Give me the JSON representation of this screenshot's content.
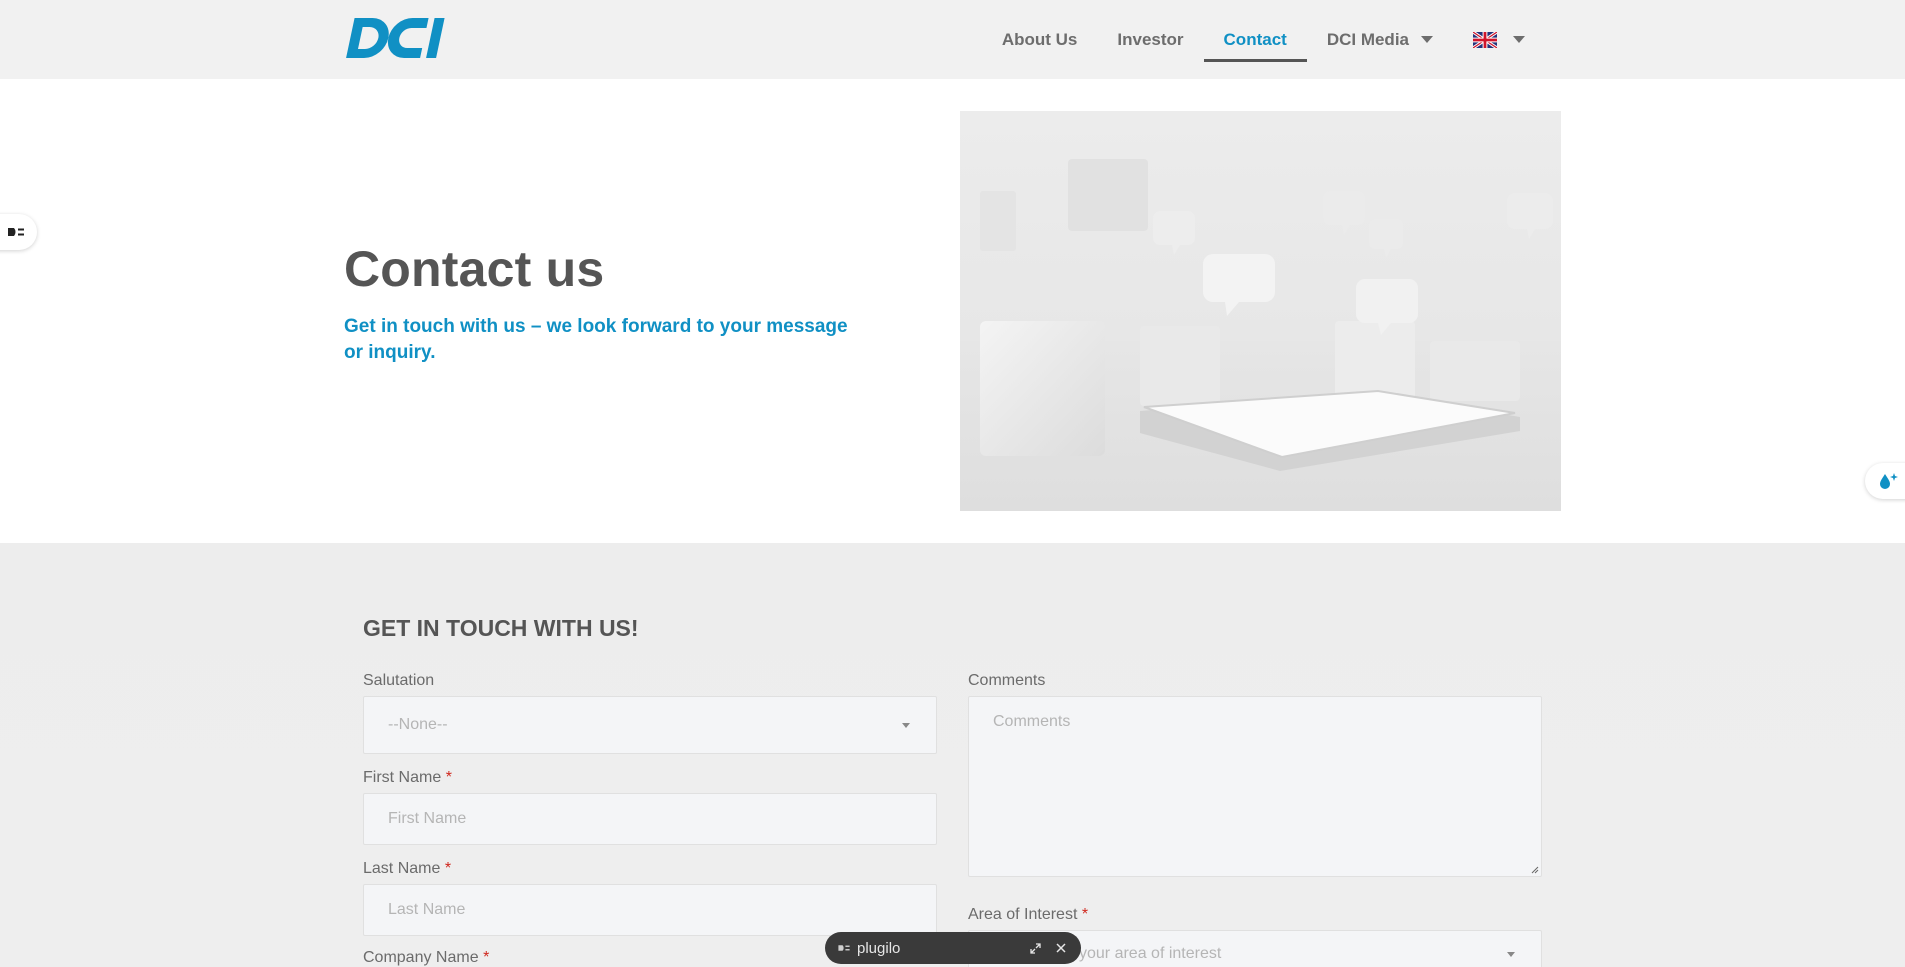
{
  "header": {
    "logo_text": "DCI",
    "nav": [
      {
        "label": "About Us"
      },
      {
        "label": "Investor"
      },
      {
        "label": "Contact",
        "active": true
      },
      {
        "label": "DCI Media",
        "has_dropdown": true
      }
    ],
    "language_flag": "uk-flag-icon"
  },
  "hero": {
    "title": "Contact us",
    "subtitle": "Get in touch with us – we look forward to your message or inquiry."
  },
  "form": {
    "title": "GET IN TOUCH WITH US!",
    "salutation": {
      "label": "Salutation",
      "value": "--None--"
    },
    "first_name": {
      "label": "First Name",
      "required": "*",
      "placeholder": "First Name"
    },
    "last_name": {
      "label": "Last Name",
      "required": "*",
      "placeholder": "Last Name"
    },
    "company_name": {
      "label": "Company Name",
      "required": "*"
    },
    "comments": {
      "label": "Comments",
      "placeholder": "Comments"
    },
    "area_of_interest": {
      "label": "Area of Interest",
      "required": "*",
      "placeholder": "your area of interest"
    }
  },
  "plugilo": {
    "label": "plugilo"
  },
  "colors": {
    "brand_blue": "#1090c4",
    "text_gray": "#555555",
    "required_red": "#d0271d"
  }
}
